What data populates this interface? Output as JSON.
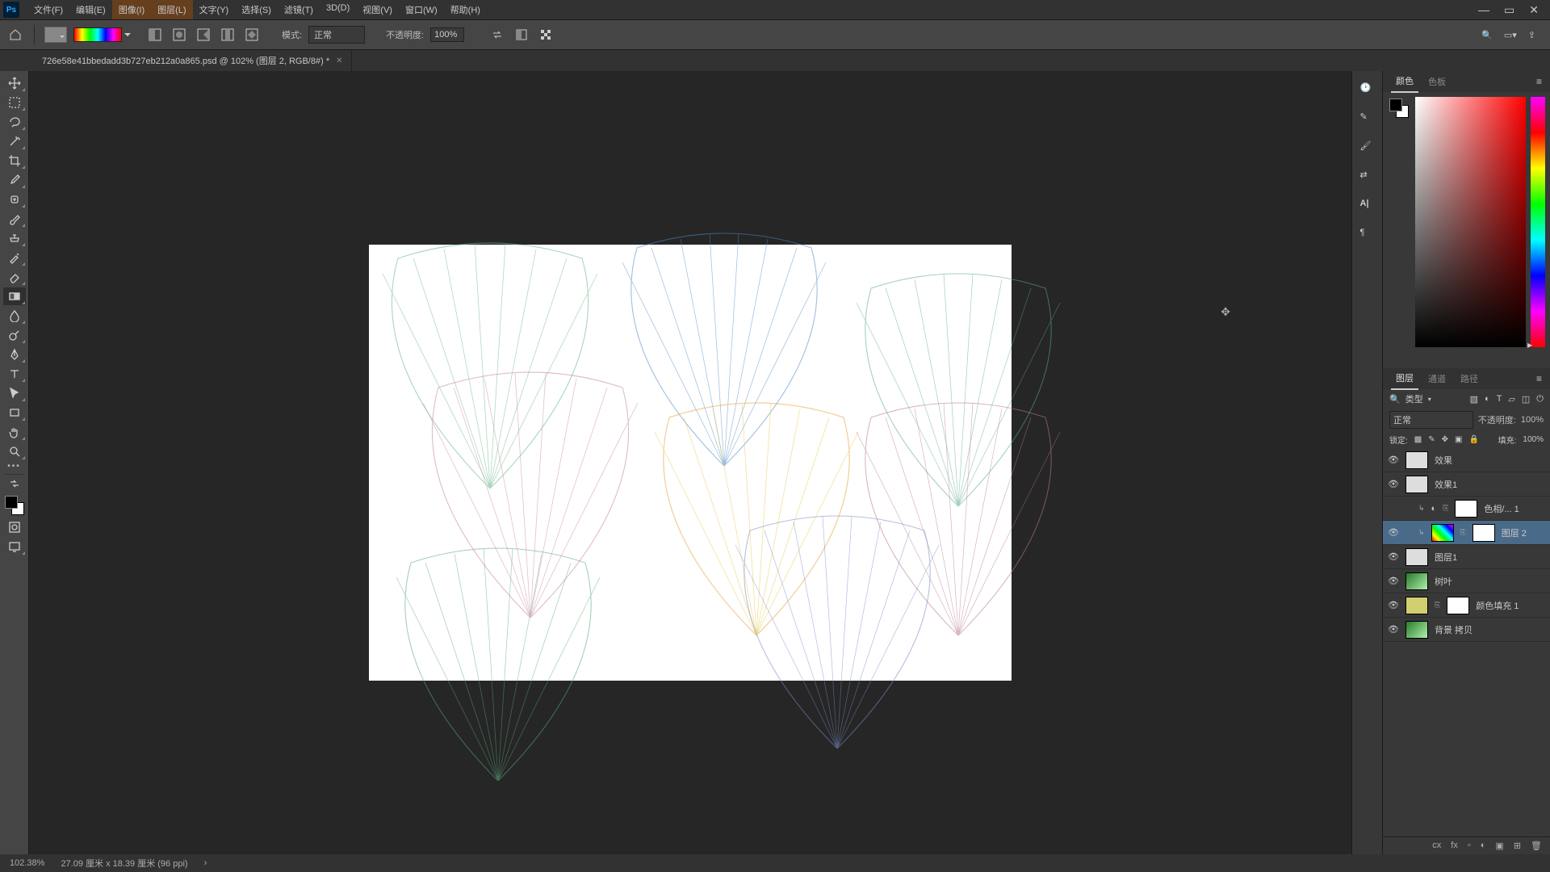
{
  "app": {
    "logo": "Ps"
  },
  "menu": [
    "文件(F)",
    "编辑(E)",
    "图像(I)",
    "图层(L)",
    "文字(Y)",
    "选择(S)",
    "滤镜(T)",
    "3D(D)",
    "视图(V)",
    "窗口(W)",
    "帮助(H)"
  ],
  "options": {
    "mode_label": "模式:",
    "mode_value": "正常",
    "opacity_label": "不透明度:",
    "opacity_value": "100%"
  },
  "tab": {
    "title": "726e58e41bbedadd3b727eb212a0a865.psd @ 102% (图层 2, RGB/8#) *"
  },
  "color_panel": {
    "tabs": [
      "颜色",
      "色板"
    ]
  },
  "layers_panel": {
    "tabs": [
      "图层",
      "通道",
      "路径"
    ],
    "filter_label": "类型",
    "blend_mode": "正常",
    "opacity_label": "不透明度:",
    "opacity_value": "100%",
    "lock_label": "锁定:",
    "fill_label": "填充:",
    "fill_value": "100%",
    "layers": [
      {
        "vis": true,
        "name": "效果",
        "thumb": "plain"
      },
      {
        "vis": true,
        "name": "效果1",
        "thumb": "plain"
      },
      {
        "vis": false,
        "name": "色相/... 1",
        "thumb": "adj",
        "mask": true,
        "indent": true
      },
      {
        "vis": true,
        "name": "图层 2",
        "thumb": "rainbow",
        "mask": true,
        "sel": true,
        "indent": true
      },
      {
        "vis": true,
        "name": "图层1",
        "thumb": "plain"
      },
      {
        "vis": true,
        "name": "树叶",
        "thumb": "green"
      },
      {
        "vis": true,
        "name": "颜色填充 1",
        "thumb": "color",
        "mask": true
      },
      {
        "vis": true,
        "name": "背景 拷贝",
        "thumb": "green"
      }
    ]
  },
  "status": {
    "zoom": "102.38%",
    "dims": "27.09 厘米 x 18.39 厘米 (96 ppi)"
  },
  "foot_icons": [
    "cx",
    "fx",
    "▫",
    "◐",
    "▣",
    "⊞",
    "⊡",
    "🗑"
  ]
}
